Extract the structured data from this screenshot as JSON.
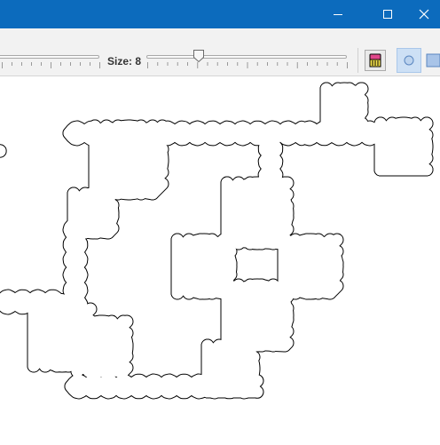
{
  "window": {
    "minimize_label": "minimize",
    "maximize_label": "maximize",
    "close_label": "close"
  },
  "toolbar": {
    "size_label": "Size: 8",
    "size_value": 8,
    "size_slider_fraction": 0.26
  },
  "icons": {
    "minimize": "minimize-icon",
    "maximize": "maximize-icon",
    "close": "close-icon",
    "eraser": "eraser-icon",
    "circle_shape": "circle-shape-icon",
    "square_shape": "square-shape-icon"
  },
  "colors": {
    "titlebar": "#0c6bbd",
    "toolbar": "#f2f2f2",
    "canvas": "#ffffff",
    "knot_stroke": "#000000",
    "selected_tool": "#cde0f5"
  }
}
